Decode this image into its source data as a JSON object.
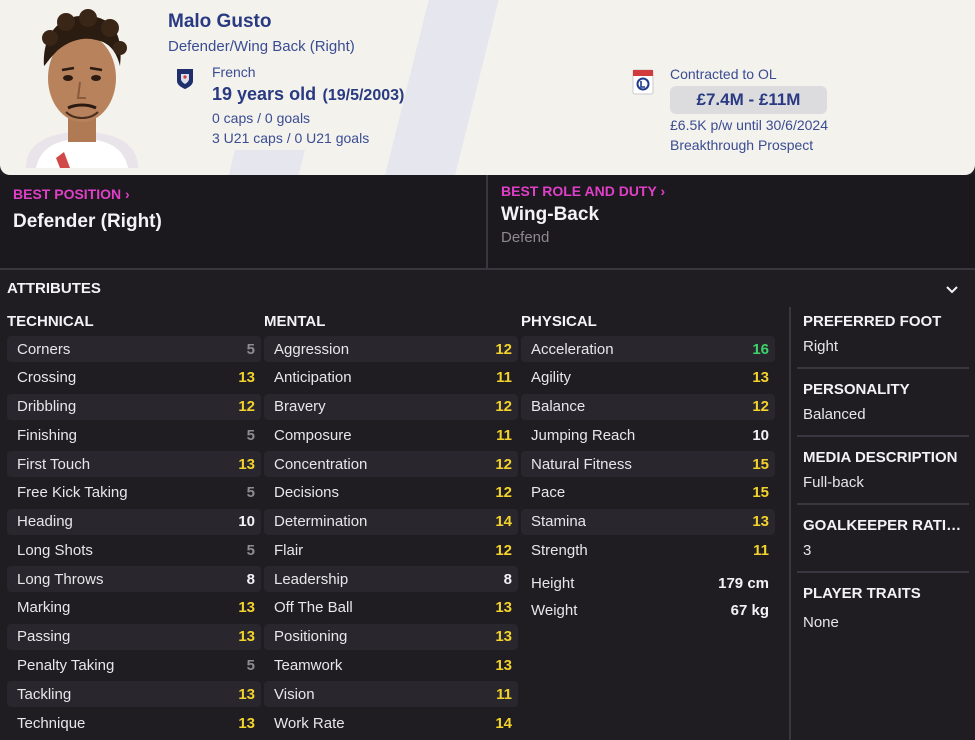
{
  "player": {
    "name": "Malo Gusto",
    "position": "Defender/Wing Back (Right)",
    "nationality": "French",
    "age": "19 years old",
    "dob": "(19/5/2003)",
    "caps": "0 caps / 0 goals",
    "u21caps": "3 U21 caps / 0 U21 goals"
  },
  "contract": {
    "club_line": "Contracted to OL",
    "value": "£7.4M - £11M",
    "wage": "£6.5K p/w until 30/6/2024",
    "status": "Breakthrough Prospect"
  },
  "best": {
    "position_title": "BEST POSITION",
    "position_value": "Defender (Right)",
    "role_title": "BEST ROLE AND DUTY",
    "role_value": "Wing-Back",
    "role_duty": "Defend"
  },
  "attributes": {
    "heading": "ATTRIBUTES",
    "technical": {
      "title": "TECHNICAL",
      "items": [
        {
          "label": "Corners",
          "value": "5",
          "tier": "grey"
        },
        {
          "label": "Crossing",
          "value": "13",
          "tier": "yellow"
        },
        {
          "label": "Dribbling",
          "value": "12",
          "tier": "yellow"
        },
        {
          "label": "Finishing",
          "value": "5",
          "tier": "grey"
        },
        {
          "label": "First Touch",
          "value": "13",
          "tier": "yellow"
        },
        {
          "label": "Free Kick Taking",
          "value": "5",
          "tier": "grey"
        },
        {
          "label": "Heading",
          "value": "10",
          "tier": "white"
        },
        {
          "label": "Long Shots",
          "value": "5",
          "tier": "grey"
        },
        {
          "label": "Long Throws",
          "value": "8",
          "tier": "white"
        },
        {
          "label": "Marking",
          "value": "13",
          "tier": "yellow"
        },
        {
          "label": "Passing",
          "value": "13",
          "tier": "yellow"
        },
        {
          "label": "Penalty Taking",
          "value": "5",
          "tier": "grey"
        },
        {
          "label": "Tackling",
          "value": "13",
          "tier": "yellow"
        },
        {
          "label": "Technique",
          "value": "13",
          "tier": "yellow"
        }
      ]
    },
    "mental": {
      "title": "MENTAL",
      "items": [
        {
          "label": "Aggression",
          "value": "12",
          "tier": "yellow"
        },
        {
          "label": "Anticipation",
          "value": "11",
          "tier": "yellow"
        },
        {
          "label": "Bravery",
          "value": "12",
          "tier": "yellow"
        },
        {
          "label": "Composure",
          "value": "11",
          "tier": "yellow"
        },
        {
          "label": "Concentration",
          "value": "12",
          "tier": "yellow"
        },
        {
          "label": "Decisions",
          "value": "12",
          "tier": "yellow"
        },
        {
          "label": "Determination",
          "value": "14",
          "tier": "yellow"
        },
        {
          "label": "Flair",
          "value": "12",
          "tier": "yellow"
        },
        {
          "label": "Leadership",
          "value": "8",
          "tier": "white"
        },
        {
          "label": "Off The Ball",
          "value": "13",
          "tier": "yellow"
        },
        {
          "label": "Positioning",
          "value": "13",
          "tier": "yellow"
        },
        {
          "label": "Teamwork",
          "value": "13",
          "tier": "yellow"
        },
        {
          "label": "Vision",
          "value": "11",
          "tier": "yellow"
        },
        {
          "label": "Work Rate",
          "value": "14",
          "tier": "yellow"
        }
      ]
    },
    "physical": {
      "title": "PHYSICAL",
      "items": [
        {
          "label": "Acceleration",
          "value": "16",
          "tier": "green"
        },
        {
          "label": "Agility",
          "value": "13",
          "tier": "yellow"
        },
        {
          "label": "Balance",
          "value": "12",
          "tier": "yellow"
        },
        {
          "label": "Jumping Reach",
          "value": "10",
          "tier": "white"
        },
        {
          "label": "Natural Fitness",
          "value": "15",
          "tier": "yellow"
        },
        {
          "label": "Pace",
          "value": "15",
          "tier": "yellow"
        },
        {
          "label": "Stamina",
          "value": "13",
          "tier": "yellow"
        },
        {
          "label": "Strength",
          "value": "11",
          "tier": "yellow"
        }
      ],
      "height_label": "Height",
      "height_value": "179 cm",
      "weight_label": "Weight",
      "weight_value": "67 kg"
    }
  },
  "side": [
    {
      "title": "PREFERRED FOOT",
      "value": "Right"
    },
    {
      "title": "PERSONALITY",
      "value": "Balanced"
    },
    {
      "title": "MEDIA DESCRIPTION",
      "value": "Full-back"
    },
    {
      "title": "GOALKEEPER RATING",
      "value": "3"
    },
    {
      "title": "PLAYER TRAITS",
      "value": "None"
    }
  ],
  "colors": {
    "accent_magenta": "#e040c8",
    "value_green": "#3fd26a",
    "value_yellow": "#f2d22c",
    "value_grey": "#8f8b93",
    "header_navy": "#2a3a82"
  },
  "icons": {
    "flag": "france-federation-icon",
    "club": "ol-club-crest-icon",
    "expand": "chevron-down-icon",
    "link": "chevron-right-icon"
  }
}
